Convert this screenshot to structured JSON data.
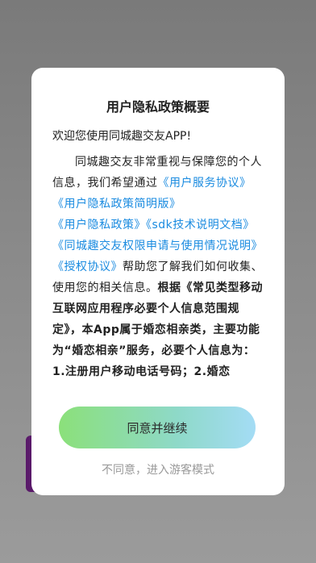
{
  "dialog": {
    "title": "用户隐私政策概要",
    "greeting": "欢迎您使用同城趣交友APP!",
    "body": {
      "intro": "同城趣交友非常重视与保障您的个人信息，我们希望通过",
      "link1": "《用户服务协议》",
      "link2": "《用户隐私政策简明版》",
      "link3": "《用户隐私政策》",
      "link4": "《sdk技术说明文档》",
      "link5": "《同城趣交友权限申请与使用情况说明》",
      "link6": "《授权协议》",
      "mid": "帮助您了解我们如何收集、使用您的相关信息。",
      "bold": "根据《常见类型移动互联网应用程序必要个人信息范围规定》，本App属于婚恋相亲类，主要功能为“婚恋相亲”服务，必要个人信息为：1.注册用户移动电话号码；2.婚恋"
    },
    "agree_label": "同意并继续",
    "disagree_label": "不同意，进入游客模式"
  }
}
